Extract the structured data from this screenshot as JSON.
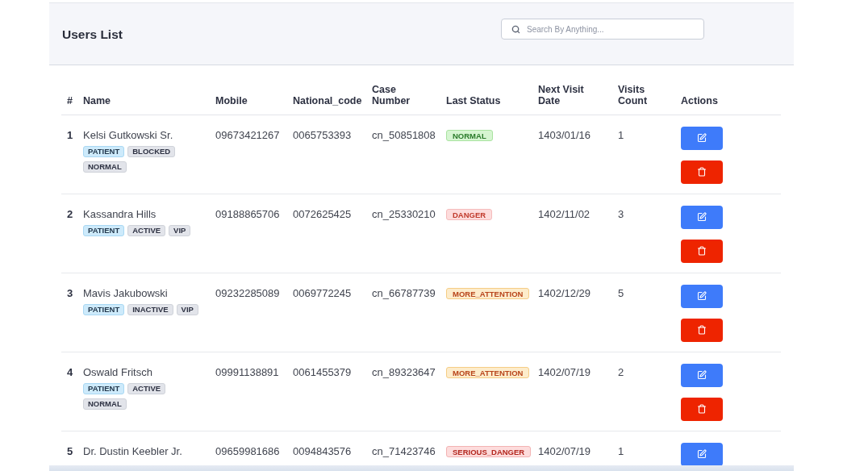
{
  "page": {
    "title": "Users List"
  },
  "search": {
    "placeholder": "Search By Anything..."
  },
  "table": {
    "columns": [
      {
        "label": "#"
      },
      {
        "label": "Name"
      },
      {
        "label": "Mobile"
      },
      {
        "label": "National_code"
      },
      {
        "label": "Case Number"
      },
      {
        "label": "Last Status"
      },
      {
        "label": "Next Visit Date"
      },
      {
        "label": "Visits Count"
      },
      {
        "label": "Actions"
      }
    ],
    "rows": [
      {
        "index": "1",
        "name": "Kelsi Gutkowski Sr.",
        "tags": [
          {
            "label": "PATIENT",
            "kind": "role"
          },
          {
            "label": "BLOCKED",
            "kind": "flag"
          },
          {
            "label": "NORMAL",
            "kind": "flag"
          }
        ],
        "mobile": "09673421267",
        "national_code": "0065753393",
        "case_number": "cn_50851808",
        "last_status": {
          "label": "NORMAL",
          "kind": "normal"
        },
        "next_visit_date": "1403/01/16",
        "visits_count": "1",
        "actions": [
          {
            "kind": "edit"
          },
          {
            "kind": "delete"
          }
        ]
      },
      {
        "index": "2",
        "name": "Kassandra Hills",
        "tags": [
          {
            "label": "PATIENT",
            "kind": "role"
          },
          {
            "label": "ACTIVE",
            "kind": "flag"
          },
          {
            "label": "VIP",
            "kind": "flag"
          }
        ],
        "mobile": "09188865706",
        "national_code": "0072625425",
        "case_number": "cn_25330210",
        "last_status": {
          "label": "DANGER",
          "kind": "danger"
        },
        "next_visit_date": "1402/11/02",
        "visits_count": "3",
        "actions": [
          {
            "kind": "edit"
          },
          {
            "kind": "delete"
          }
        ]
      },
      {
        "index": "3",
        "name": "Mavis Jakubowski",
        "tags": [
          {
            "label": "PATIENT",
            "kind": "role"
          },
          {
            "label": "INACTIVE",
            "kind": "flag"
          },
          {
            "label": "VIP",
            "kind": "flag"
          }
        ],
        "mobile": "09232285089",
        "national_code": "0069772245",
        "case_number": "cn_66787739",
        "last_status": {
          "label": "MORE_ATTENTION",
          "kind": "more_attention"
        },
        "next_visit_date": "1402/12/29",
        "visits_count": "5",
        "actions": [
          {
            "kind": "edit"
          },
          {
            "kind": "delete"
          }
        ]
      },
      {
        "index": "4",
        "name": "Oswald Fritsch",
        "tags": [
          {
            "label": "PATIENT",
            "kind": "role"
          },
          {
            "label": "ACTIVE",
            "kind": "flag"
          },
          {
            "label": "NORMAL",
            "kind": "flag"
          }
        ],
        "mobile": "09991138891",
        "national_code": "0061455379",
        "case_number": "cn_89323647",
        "last_status": {
          "label": "MORE_ATTENTION",
          "kind": "more_attention"
        },
        "next_visit_date": "1402/07/19",
        "visits_count": "2",
        "actions": [
          {
            "kind": "edit"
          },
          {
            "kind": "delete"
          }
        ]
      },
      {
        "index": "5",
        "name": "Dr. Dustin Keebler Jr.",
        "tags": [],
        "mobile": "09659981686",
        "national_code": "0094843576",
        "case_number": "cn_71423746",
        "last_status": {
          "label": "SERIOUS_DANGER",
          "kind": "serious_danger"
        },
        "next_visit_date": "1402/07/19",
        "visits_count": "1",
        "actions": [
          {
            "kind": "edit"
          }
        ]
      }
    ]
  }
}
